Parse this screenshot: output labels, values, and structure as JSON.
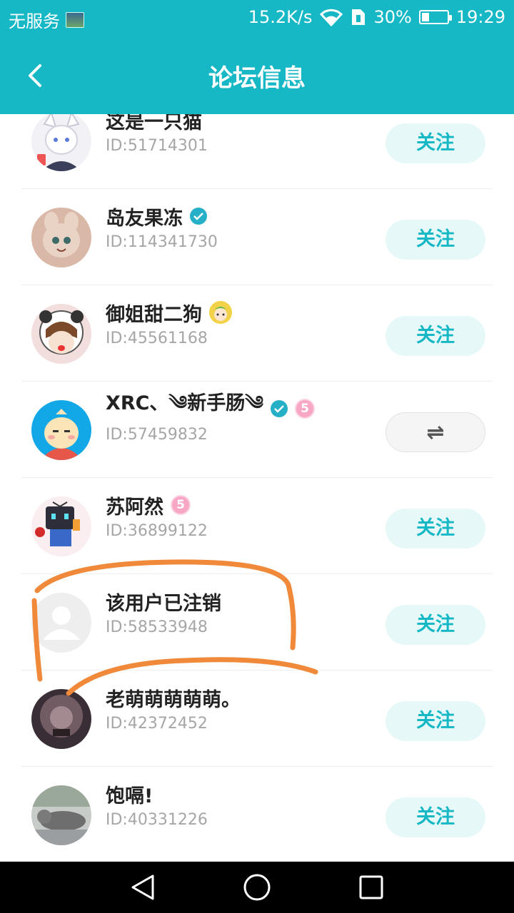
{
  "status_bar": {
    "carrier": "无服务",
    "speed": "15.2K/s",
    "battery_percent": "30%",
    "battery_level": 0.3,
    "time": "19:29"
  },
  "header": {
    "title": "论坛信息"
  },
  "users": [
    {
      "name": "这是一只猫",
      "id": "ID:51714301",
      "action": "关注"
    },
    {
      "name": "岛友果冻",
      "id": "ID:114341730",
      "action": "关注"
    },
    {
      "name": "御姐甜二狗",
      "id": "ID:45561168",
      "action": "关注"
    },
    {
      "name": "XRC、༄新手肠༄",
      "id": "ID:57459832",
      "action": "⇌"
    },
    {
      "name": "苏阿然",
      "id": "ID:36899122",
      "action": "关注"
    },
    {
      "name": "该用户已注销",
      "id": "ID:58533948",
      "action": "关注"
    },
    {
      "name": "老萌萌萌萌萌。",
      "id": "ID:42372452",
      "action": "关注"
    },
    {
      "name": "饱嗝!",
      "id": "ID:40331226",
      "action": "关注"
    }
  ],
  "badges": {
    "level_xrc": "5",
    "level_su": "5"
  },
  "colors": {
    "accent": "#17b8c6",
    "follow_bg": "#e7f8f9",
    "annotation": "#f0893a"
  }
}
